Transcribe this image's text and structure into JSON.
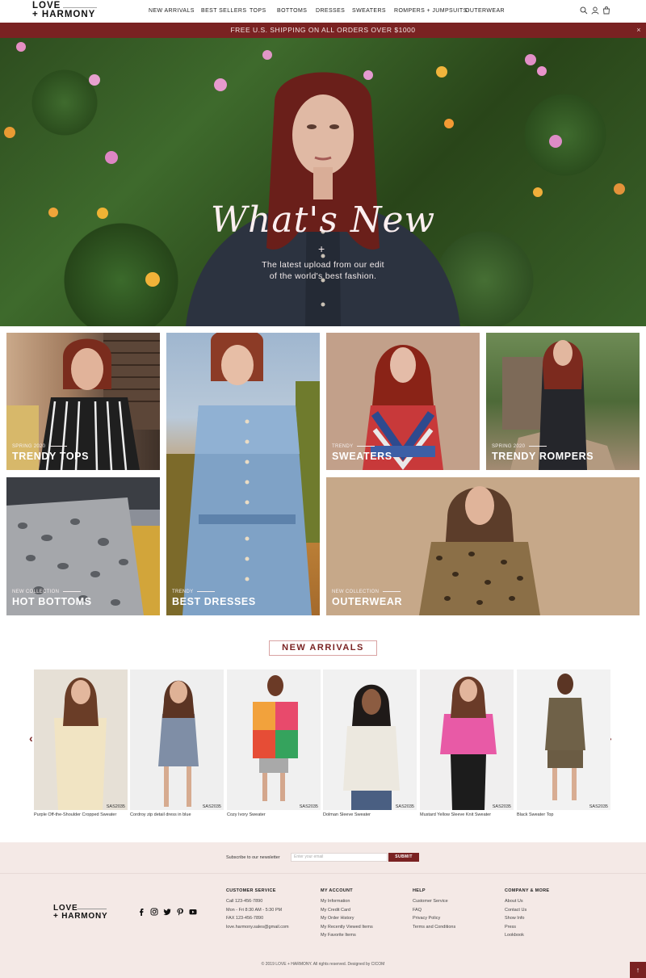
{
  "brand": {
    "line1": "LOVE",
    "line2": "+ HARMONY"
  },
  "nav": [
    "NEW ARRIVALS",
    "BEST SELLERS",
    "TOPS",
    "BOTTOMS",
    "DRESSES",
    "SWEATERS",
    "ROMPERS + JUMPSUITS",
    "OUTERWEAR"
  ],
  "header_icons": [
    "search-icon",
    "user-icon",
    "cart-icon"
  ],
  "announcement": {
    "text": "FREE U.S. SHIPPING ON ALL ORDERS OVER $1000",
    "close": "×"
  },
  "hero": {
    "title": "What's New",
    "plus": "+",
    "subtitle_line1": "The latest upload from our edit",
    "subtitle_line2": "of the world's best fashion."
  },
  "categories": [
    {
      "kicker": "SPRING 2020",
      "title": "TRENDY TOPS"
    },
    {
      "kicker": "TRENDY",
      "title": "BEST DRESSES"
    },
    {
      "kicker": "TRENDY",
      "title": "SWEATERS"
    },
    {
      "kicker": "SPRING 2020",
      "title": "TRENDY ROMPERS"
    },
    {
      "kicker": "NEW COLLECTION",
      "title": "HOT BOTTOMS"
    },
    {
      "kicker": "NEW COLLECTION",
      "title": "OUTERWEAR"
    }
  ],
  "new_arrivals": {
    "heading": "NEW ARRIVALS",
    "prev": "‹",
    "next": "›",
    "products": [
      {
        "name": "Purple Off-the-Shoulder Cropped Sweater",
        "sku": "SAS2035"
      },
      {
        "name": "Cordroy zip detail dress in blue",
        "sku": "SAS2035"
      },
      {
        "name": "Cozy Ivory Sweater",
        "sku": "SAS2035"
      },
      {
        "name": "Dolman Sleeve Sweater",
        "sku": "SAS2035"
      },
      {
        "name": "Mustard Yellow Sleeve Knit Sweater",
        "sku": "SAS2035"
      },
      {
        "name": "Black Sweater Top",
        "sku": "SAS2035"
      }
    ]
  },
  "newsletter": {
    "label": "Subscribe to our newsletter",
    "placeholder": "Enter your email",
    "button": "SUBMIT"
  },
  "footer": {
    "logo_line1": "LOVE",
    "logo_line2": "+ HARMONY",
    "social": [
      "facebook-icon",
      "instagram-icon",
      "twitter-icon",
      "pinterest-icon",
      "youtube-icon"
    ],
    "columns": [
      {
        "heading": "CUSTOMER SERVICE",
        "items": [
          "Call 123-456-7890",
          "Mon - Fri 8:30 AM - 5:30 PM",
          "FAX 123-456-7890",
          "love.harmony.sales@gmail.com"
        ]
      },
      {
        "heading": "MY ACCOUNT",
        "items": [
          "My Information",
          "My Credit Card",
          "My Order History",
          "My Recently Viewed Items",
          "My Favorite Items"
        ]
      },
      {
        "heading": "HELP",
        "items": [
          "Customer Service",
          "FAQ",
          "Privacy Policy",
          "Terms and Conditions"
        ]
      },
      {
        "heading": "COMPANY & MORE",
        "items": [
          "About Us",
          "Contact Us",
          "Show Info",
          "Press",
          "Lookbook"
        ]
      }
    ],
    "copyright": "© 2019 LOVE + HARMONY. All rights reserved. Designed by CICOM",
    "to_top": "↑"
  },
  "colors": {
    "accent": "#7a2222",
    "footer_bg": "#f4e9e6"
  }
}
